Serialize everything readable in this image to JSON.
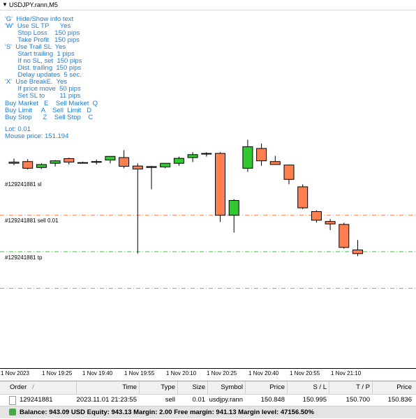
{
  "window": {
    "title": "USDJPY.rann,M5"
  },
  "info": {
    "lines": [
      "'G'  Hide/Show info text",
      "'W'  Use SL TP      Yes",
      "       Stop Loss    150 pips",
      "       Take Profit   150 pips",
      "'S'  Use Trail SL  Yes",
      "       Start trailing  1 pips",
      "       If no SL, set  150 pips",
      "       Dist. trailing  150 pips",
      "       Delay updates  5 sec.",
      "'X'  Use BreakE.  Yes",
      "       If price move  50 pips",
      "       Set SL to        11 pips"
    ],
    "hotkeys": [
      "Buy Market   E    Sell Market  Q",
      "Buy Limit     A    Sell  Limit   D",
      "Buy Stop      Z    Sell Stop    C"
    ],
    "lot": "Lot: 0.01",
    "mouse_price": "Mouse price: 151.194"
  },
  "lines": {
    "sl_label": "#129241881 sl",
    "sell_label": "#129241881 sell 0.01",
    "tp_label": "#129241881 tp"
  },
  "colors": {
    "bull": "#32c832",
    "bear": "#ff7f50",
    "sl_line": "#ff7f50",
    "entry_line": "#32c832",
    "tp_line": "#ff7f50",
    "info_text": "#1f7fd6"
  },
  "time_axis": {
    "labels": [
      "1 Nov 2023",
      "1 Nov 19:25",
      "1 Nov 19:40",
      "1 Nov 19:55",
      "1 Nov 20:10",
      "1 Nov 20:25",
      "1 Nov 20:40",
      "1 Nov 20:55",
      "1 Nov 21:10"
    ]
  },
  "candles": [
    {
      "o": 151.21,
      "h": 151.224,
      "l": 151.198,
      "c": 151.205
    },
    {
      "o": 151.212,
      "h": 151.222,
      "l": 151.18,
      "c": 151.185
    },
    {
      "o": 151.188,
      "h": 151.205,
      "l": 151.182,
      "c": 151.2
    },
    {
      "o": 151.205,
      "h": 151.218,
      "l": 151.192,
      "c": 151.215
    },
    {
      "o": 151.224,
      "h": 151.228,
      "l": 151.2,
      "c": 151.21
    },
    {
      "o": 151.208,
      "h": 151.212,
      "l": 151.205,
      "c": 151.208
    },
    {
      "o": 151.21,
      "h": 151.22,
      "l": 151.2,
      "c": 151.212
    },
    {
      "o": 151.218,
      "h": 151.228,
      "l": 151.205,
      "c": 151.233
    },
    {
      "o": 151.228,
      "h": 151.258,
      "l": 151.185,
      "c": 151.193
    },
    {
      "o": 151.194,
      "h": 151.205,
      "l": 150.84,
      "c": 151.182
    },
    {
      "o": 151.188,
      "h": 151.195,
      "l": 151.1,
      "c": 151.192
    },
    {
      "o": 151.19,
      "h": 151.205,
      "l": 151.185,
      "c": 151.205
    },
    {
      "o": 151.205,
      "h": 151.232,
      "l": 151.195,
      "c": 151.225
    },
    {
      "o": 151.228,
      "h": 151.25,
      "l": 151.21,
      "c": 151.24
    },
    {
      "o": 151.242,
      "h": 151.25,
      "l": 151.232,
      "c": 151.245
    },
    {
      "o": 151.245,
      "h": 151.25,
      "l": 150.968,
      "c": 150.995
    },
    {
      "o": 150.995,
      "h": 151.06,
      "l": 150.925,
      "c": 151.055
    },
    {
      "o": 151.185,
      "h": 151.3,
      "l": 151.17,
      "c": 151.272
    },
    {
      "o": 151.265,
      "h": 151.285,
      "l": 151.195,
      "c": 151.215
    },
    {
      "o": 151.212,
      "h": 151.235,
      "l": 151.2,
      "c": 151.2
    },
    {
      "o": 151.198,
      "h": 151.2,
      "l": 151.12,
      "c": 151.14
    },
    {
      "o": 151.11,
      "h": 151.12,
      "l": 151.02,
      "c": 151.025
    },
    {
      "o": 151.01,
      "h": 151.015,
      "l": 150.965,
      "c": 150.975
    },
    {
      "o": 150.97,
      "h": 150.98,
      "l": 150.935,
      "c": 150.96
    },
    {
      "o": 150.958,
      "h": 150.965,
      "l": 150.86,
      "c": 150.865
    },
    {
      "o": 150.855,
      "h": 150.895,
      "l": 150.83,
      "c": 150.84
    }
  ],
  "chart_price": {
    "sl": 150.995,
    "entry": 150.848,
    "tp": 150.7
  },
  "terminal": {
    "headers": {
      "order": "Order",
      "time": "Time",
      "type": "Type",
      "size": "Size",
      "symbol": "Symbol",
      "price": "Price",
      "sl": "S / L",
      "tp": "T / P",
      "price2": "Price"
    },
    "row": {
      "order": "129241881",
      "time": "2023.11.01 21:23:55",
      "type": "sell",
      "size": "0.01",
      "symbol": "usdjpy.rann",
      "price": "150.848",
      "sl": "150.995",
      "tp": "150.700",
      "price2": "150.836"
    },
    "status": "Balance: 943.09 USD  Equity: 943.13  Margin: 2.00  Free margin: 941.13  Margin level: 47156.50%"
  }
}
